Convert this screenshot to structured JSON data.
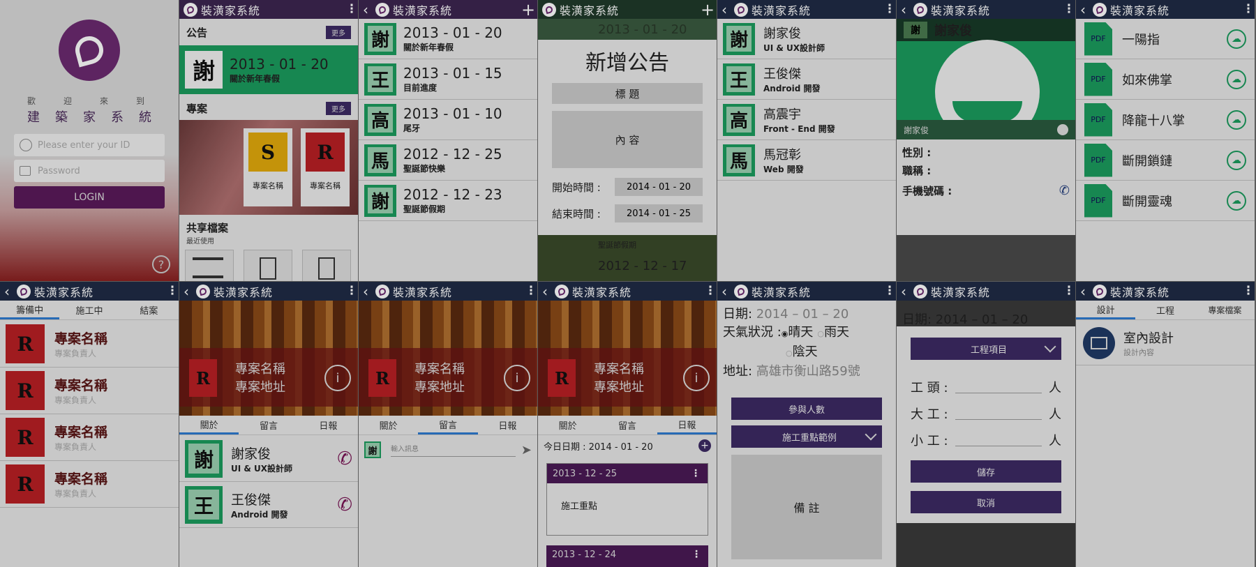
{
  "app_name": "裝潢家系統",
  "login": {
    "welcome": "歡迎來到",
    "app_name": "建築家系統",
    "id_placeholder": "Please enter your ID",
    "password_placeholder": "Password",
    "button": "LOGIN"
  },
  "dashboard": {
    "announce_header": "公告",
    "more": "更多",
    "latest": {
      "avatar": "謝",
      "date": "2013 - 01 - 20",
      "title": "關於新年春假"
    },
    "project_header": "專案",
    "cards": [
      {
        "letter": "S",
        "name": "專案名稱"
      },
      {
        "letter": "R",
        "name": "專案名稱"
      }
    ],
    "share_header": "共享檔案",
    "share_sub": "最近使用"
  },
  "announcements": [
    {
      "avatar": "謝",
      "date": "2013 - 01 - 20",
      "title": "關於新年春假"
    },
    {
      "avatar": "王",
      "date": "2013 - 01 - 15",
      "title": "目前進度"
    },
    {
      "avatar": "高",
      "date": "2013 - 01 - 10",
      "title": "尾牙"
    },
    {
      "avatar": "馬",
      "date": "2012 - 12 - 25",
      "title": "聖誕節快樂"
    },
    {
      "avatar": "謝",
      "date": "2012 - 12 - 23",
      "title": "聖誕節假期"
    }
  ],
  "new_announcement": {
    "bg_date": "2013 - 01 - 20",
    "title": "新增公告",
    "title_field": "標 題",
    "content_field": "內 容",
    "start_label": "開始時間 :",
    "start": "2014 - 01 - 20",
    "end_label": "結束時間 :",
    "end": "2014 - 01 - 25",
    "bg_sub": "聖誕節假期",
    "bg_date2": "2012 - 12 - 17"
  },
  "team": [
    {
      "avatar": "謝",
      "name": "謝家俊",
      "role": "UI & UX設計師"
    },
    {
      "avatar": "王",
      "name": "王俊傑",
      "role": "Android 開發"
    },
    {
      "avatar": "高",
      "name": "高震宇",
      "role": "Front - End 開發"
    },
    {
      "avatar": "馬",
      "name": "馬冠彰",
      "role": "Web 開發"
    }
  ],
  "profile": {
    "bg_avatar": "謝",
    "name": "謝家俊",
    "gender_label": "性別 :",
    "title_label": "職稱 :",
    "phone_label": "手機號碼 :"
  },
  "files": [
    {
      "icon": "PDF",
      "name": "一陽指"
    },
    {
      "icon": "PDF",
      "name": "如來佛掌"
    },
    {
      "icon": "PDF",
      "name": "降龍十八掌"
    },
    {
      "icon": "PDF",
      "name": "斷開鎖鏈"
    },
    {
      "icon": "PDF",
      "name": "斷開靈魂"
    }
  ],
  "project_list": {
    "tabs": [
      "籌備中",
      "施工中",
      "結案"
    ],
    "items": [
      {
        "letter": "R",
        "name": "專案名稱",
        "owner": "專案負責人"
      },
      {
        "letter": "R",
        "name": "專案名稱",
        "owner": "專案負責人"
      },
      {
        "letter": "R",
        "name": "專案名稱",
        "owner": "專案負責人"
      },
      {
        "letter": "R",
        "name": "專案名稱",
        "owner": "專案負責人"
      }
    ]
  },
  "project": {
    "letter": "R",
    "name": "專案名稱",
    "address": "專案地址",
    "tabs": [
      "關於",
      "留言",
      "日報"
    ],
    "members": [
      {
        "avatar": "謝",
        "name": "謝家俊",
        "role": "UI & UX設計師"
      },
      {
        "avatar": "王",
        "name": "王俊傑",
        "role": "Android 開發"
      }
    ]
  },
  "messages": {
    "avatar": "謝",
    "placeholder": "輸入訊息"
  },
  "report": {
    "today": "今日日期 : 2014 - 01 - 20",
    "cards": [
      {
        "date": "2013 - 12 - 25",
        "body": "施工重點"
      },
      {
        "date": "2013 - 12 - 24"
      }
    ]
  },
  "form": {
    "date_label": "日期: ",
    "date": "2014 – 01 – 20",
    "weather_label": "天氣狀況 : ",
    "weather": [
      "晴天",
      "雨天",
      "陰天"
    ],
    "address_label": "地址: ",
    "address": "高雄市衡山路59號",
    "participants": "參與人數",
    "work_focus": "施工重點範例",
    "notes": "備 註"
  },
  "labor": {
    "bg_date": "日期: 2014 – 01 – 20",
    "work_item": "工程項目",
    "rows": [
      {
        "label": "工 頭 :",
        "unit": "人"
      },
      {
        "label": "大 工 :",
        "unit": "人"
      },
      {
        "label": "小 工 :",
        "unit": "人"
      }
    ],
    "save": "儲存",
    "cancel": "取消"
  },
  "files2": {
    "tabs": [
      "設計",
      "工程",
      "專案檔案"
    ],
    "item": {
      "title": "室內設計",
      "sub": "設計內容"
    }
  }
}
